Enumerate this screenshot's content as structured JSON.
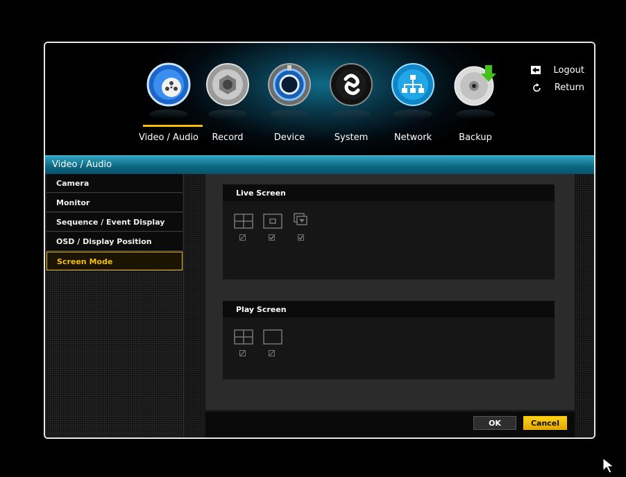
{
  "topnav": {
    "items": [
      {
        "label": "Video / Audio",
        "icon": "film-reel-icon",
        "active": true
      },
      {
        "label": "Record",
        "icon": "camera-aperture-icon",
        "active": false
      },
      {
        "label": "Device",
        "icon": "device-dial-icon",
        "active": false
      },
      {
        "label": "System",
        "icon": "system-swirl-icon",
        "active": false
      },
      {
        "label": "Network",
        "icon": "network-tree-icon",
        "active": false
      },
      {
        "label": "Backup",
        "icon": "disc-download-icon",
        "active": false
      }
    ],
    "logout_label": "Logout",
    "return_label": "Return"
  },
  "section": {
    "title": "Video / Audio"
  },
  "sidebar": {
    "items": [
      {
        "label": "Camera",
        "active": false
      },
      {
        "label": "Monitor",
        "active": false
      },
      {
        "label": "Sequence / Event Display",
        "active": false
      },
      {
        "label": "OSD / Display Position",
        "active": false
      },
      {
        "label": "Screen Mode",
        "active": true
      }
    ]
  },
  "live_screen": {
    "title": "Live Screen",
    "modes": [
      {
        "icon": "quad-split-icon",
        "checked": false
      },
      {
        "icon": "single-center-icon",
        "checked": true
      },
      {
        "icon": "pip-overlap-icon",
        "checked": true
      }
    ]
  },
  "play_screen": {
    "title": "Play Screen",
    "modes": [
      {
        "icon": "quad-split-icon",
        "checked": false
      },
      {
        "icon": "full-single-icon",
        "checked": false
      }
    ]
  },
  "buttons": {
    "ok_label": "OK",
    "cancel_label": "Cancel"
  },
  "colors": {
    "accent": "#f5c000",
    "header": "#0c6580"
  }
}
